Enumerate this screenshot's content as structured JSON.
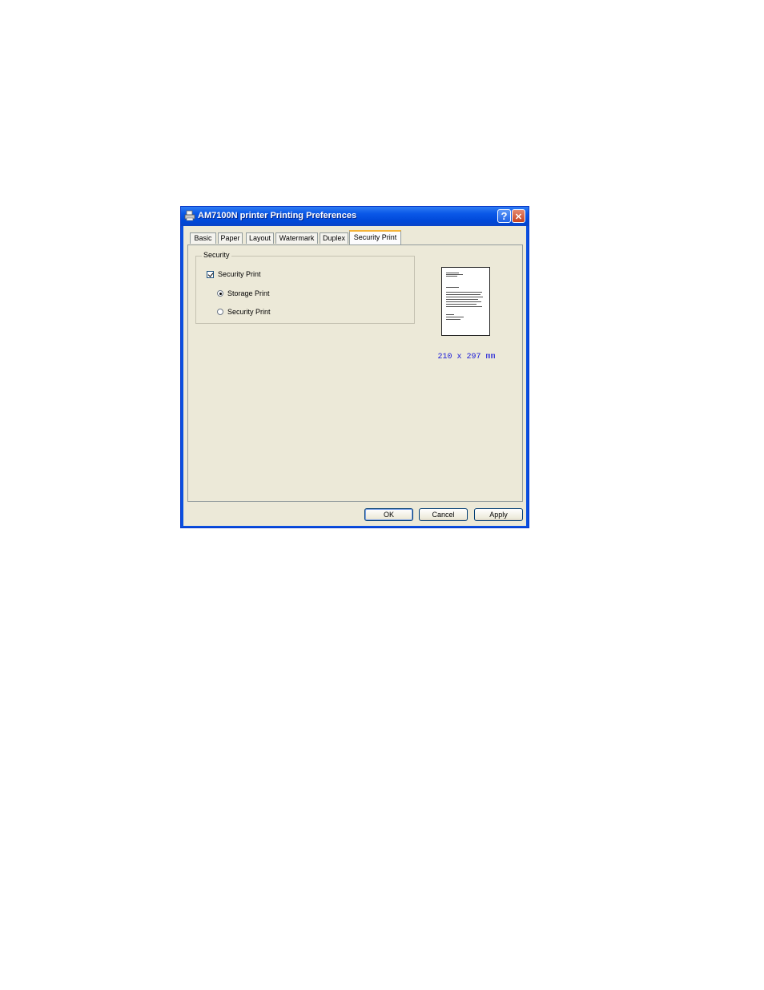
{
  "window": {
    "title": "AM7100N printer Printing Preferences",
    "icon": "printer-icon",
    "help_glyph": "?",
    "close_glyph": "✕"
  },
  "tabs": [
    {
      "label": "Basic"
    },
    {
      "label": "Paper"
    },
    {
      "label": "Layout"
    },
    {
      "label": "Watermark"
    },
    {
      "label": "Duplex"
    },
    {
      "label": "Security Print",
      "active": true
    }
  ],
  "security_group": {
    "title": "Security",
    "checkbox_label": "Security Print",
    "checkbox_checked": true,
    "radio_options": [
      {
        "label": "Storage Print",
        "selected": true
      },
      {
        "label": "Security Print",
        "selected": false
      }
    ]
  },
  "preview": {
    "paper_size": "210 x 297 mm"
  },
  "buttons": {
    "ok": "OK",
    "cancel": "Cancel",
    "apply": "Apply"
  },
  "colors": {
    "titlebar": "#0a58e8",
    "dialog_face": "#ece9d8",
    "paper_size_text": "#1818d8",
    "active_tab_accent": "#f5b43a"
  }
}
